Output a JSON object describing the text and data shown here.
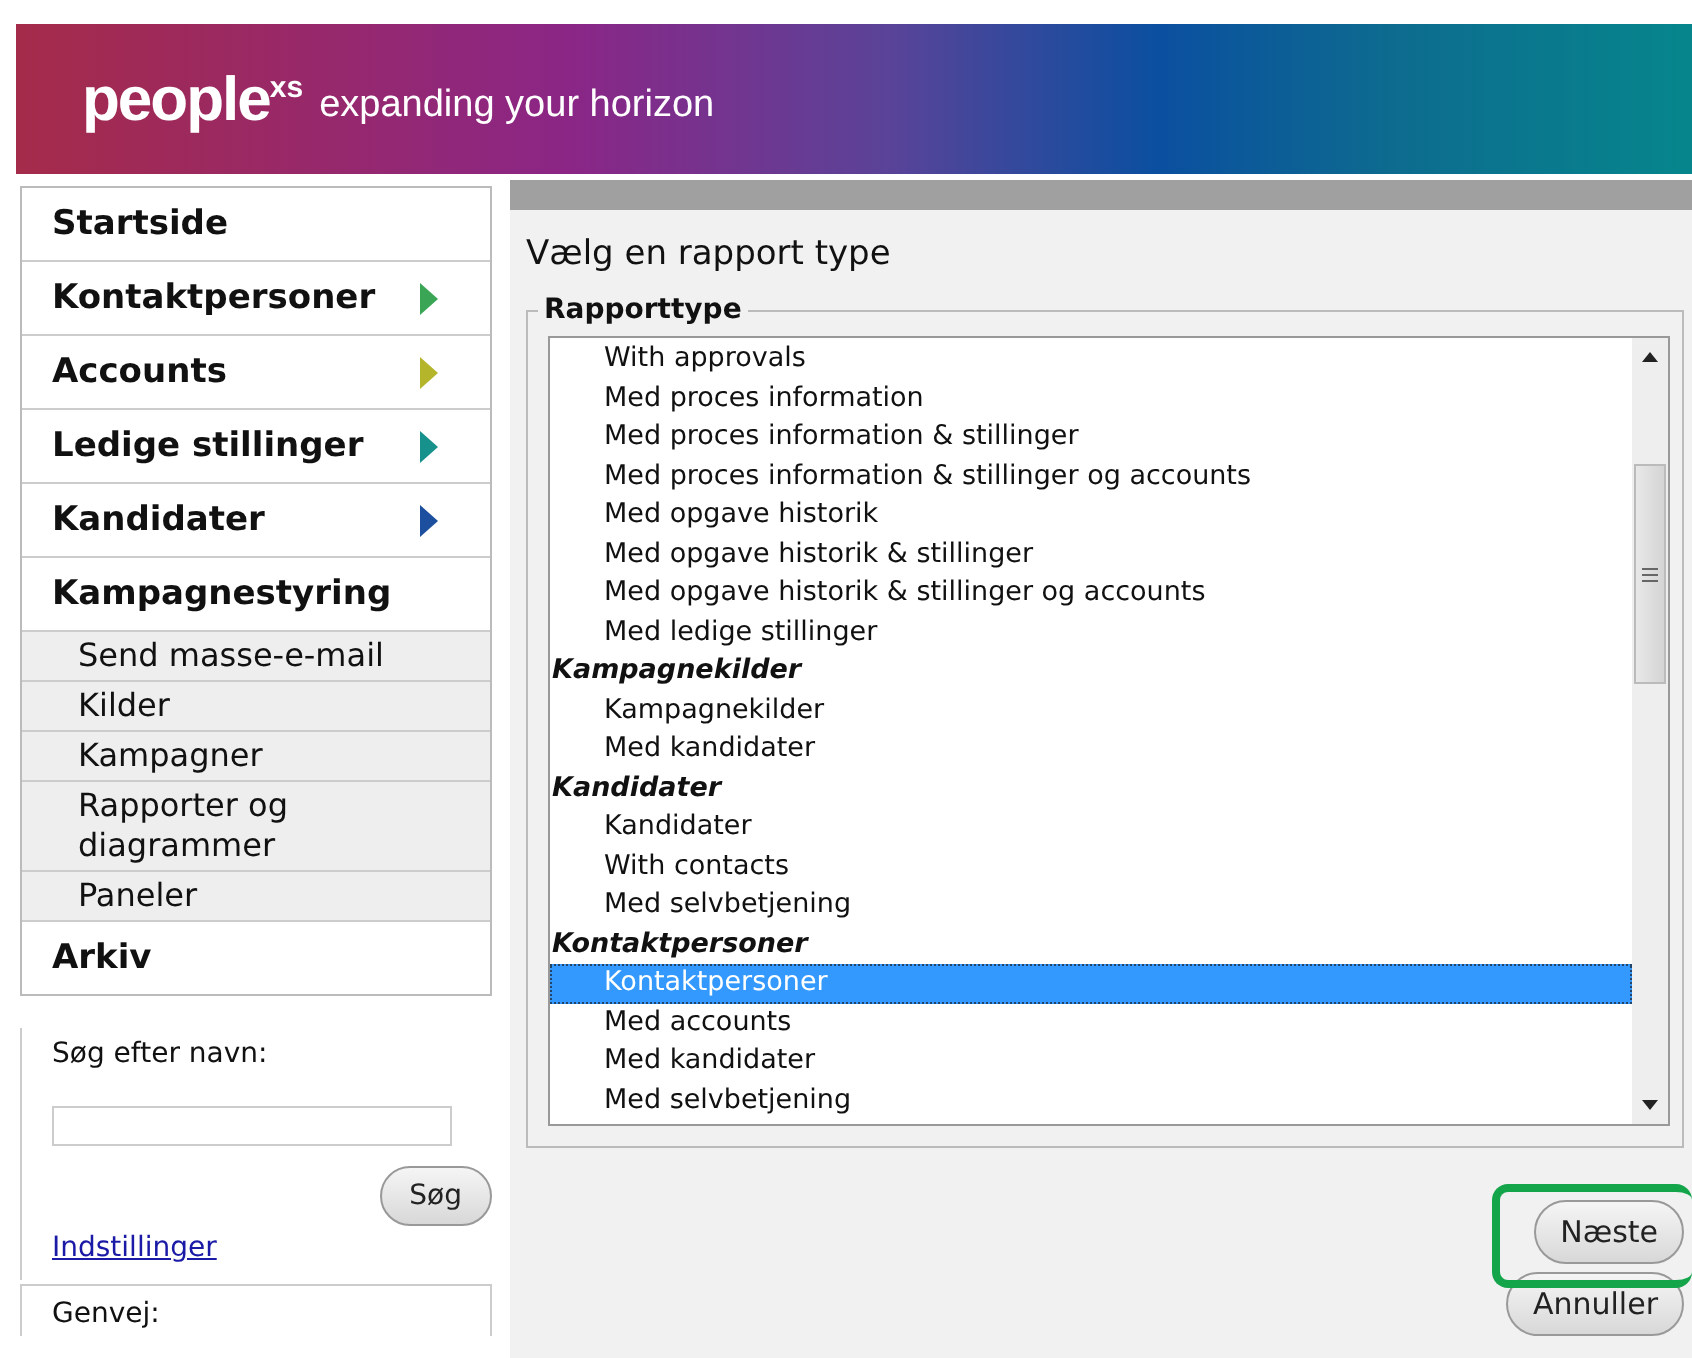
{
  "header": {
    "logo": "people",
    "logo_sup": "xs",
    "tagline": "expanding your horizon"
  },
  "sidebar": {
    "menu": [
      {
        "kind": "main",
        "label": "Startside"
      },
      {
        "kind": "main",
        "label": "Kontaktpersoner",
        "color": "#3aa655"
      },
      {
        "kind": "main",
        "label": "Accounts",
        "color": "#b5b52c"
      },
      {
        "kind": "main",
        "label": "Ledige stillinger",
        "color": "#16918c"
      },
      {
        "kind": "main",
        "label": "Kandidater",
        "color": "#1c4f9e"
      },
      {
        "kind": "main",
        "label": "Kampagnestyring"
      },
      {
        "kind": "sub",
        "label": "Send masse-e-mail"
      },
      {
        "kind": "sub",
        "label": "Kilder"
      },
      {
        "kind": "sub",
        "label": "Kampagner"
      },
      {
        "kind": "sub",
        "label": "Rapporter og diagrammer"
      },
      {
        "kind": "sub",
        "label": "Paneler"
      },
      {
        "kind": "main",
        "label": "Arkiv"
      }
    ],
    "search": {
      "label": "Søg efter navn:",
      "button": "Søg",
      "link": "Indstillinger"
    },
    "shortcuts": {
      "label": "Genvej:"
    }
  },
  "main": {
    "title": "Vælg en rapport type",
    "legend": "Rapporttype",
    "items": [
      {
        "kind": "option",
        "label": "With approvals",
        "selected": false
      },
      {
        "kind": "option",
        "label": "Med proces information",
        "selected": false
      },
      {
        "kind": "option",
        "label": "Med proces information & stillinger",
        "selected": false
      },
      {
        "kind": "option",
        "label": "Med proces information & stillinger og accounts",
        "selected": false
      },
      {
        "kind": "option",
        "label": "Med opgave historik",
        "selected": false
      },
      {
        "kind": "option",
        "label": "Med opgave historik & stillinger",
        "selected": false
      },
      {
        "kind": "option",
        "label": "Med opgave historik & stillinger og accounts",
        "selected": false
      },
      {
        "kind": "option",
        "label": "Med ledige stillinger",
        "selected": false
      },
      {
        "kind": "group",
        "label": "Kampagnekilder",
        "selected": false
      },
      {
        "kind": "option",
        "label": "Kampagnekilder",
        "selected": false
      },
      {
        "kind": "option",
        "label": "Med kandidater",
        "selected": false
      },
      {
        "kind": "group",
        "label": "Kandidater",
        "selected": false
      },
      {
        "kind": "option",
        "label": "Kandidater",
        "selected": false
      },
      {
        "kind": "option",
        "label": "With contacts",
        "selected": false
      },
      {
        "kind": "option",
        "label": "Med selvbetjening",
        "selected": false
      },
      {
        "kind": "group",
        "label": "Kontaktpersoner",
        "selected": false
      },
      {
        "kind": "option",
        "label": "Kontaktpersoner",
        "selected": true
      },
      {
        "kind": "option",
        "label": "Med accounts",
        "selected": false
      },
      {
        "kind": "option",
        "label": "Med kandidater",
        "selected": false
      },
      {
        "kind": "option",
        "label": "Med selvbetjening",
        "selected": false
      }
    ],
    "buttons": [
      "Næste",
      "Annuller"
    ]
  }
}
